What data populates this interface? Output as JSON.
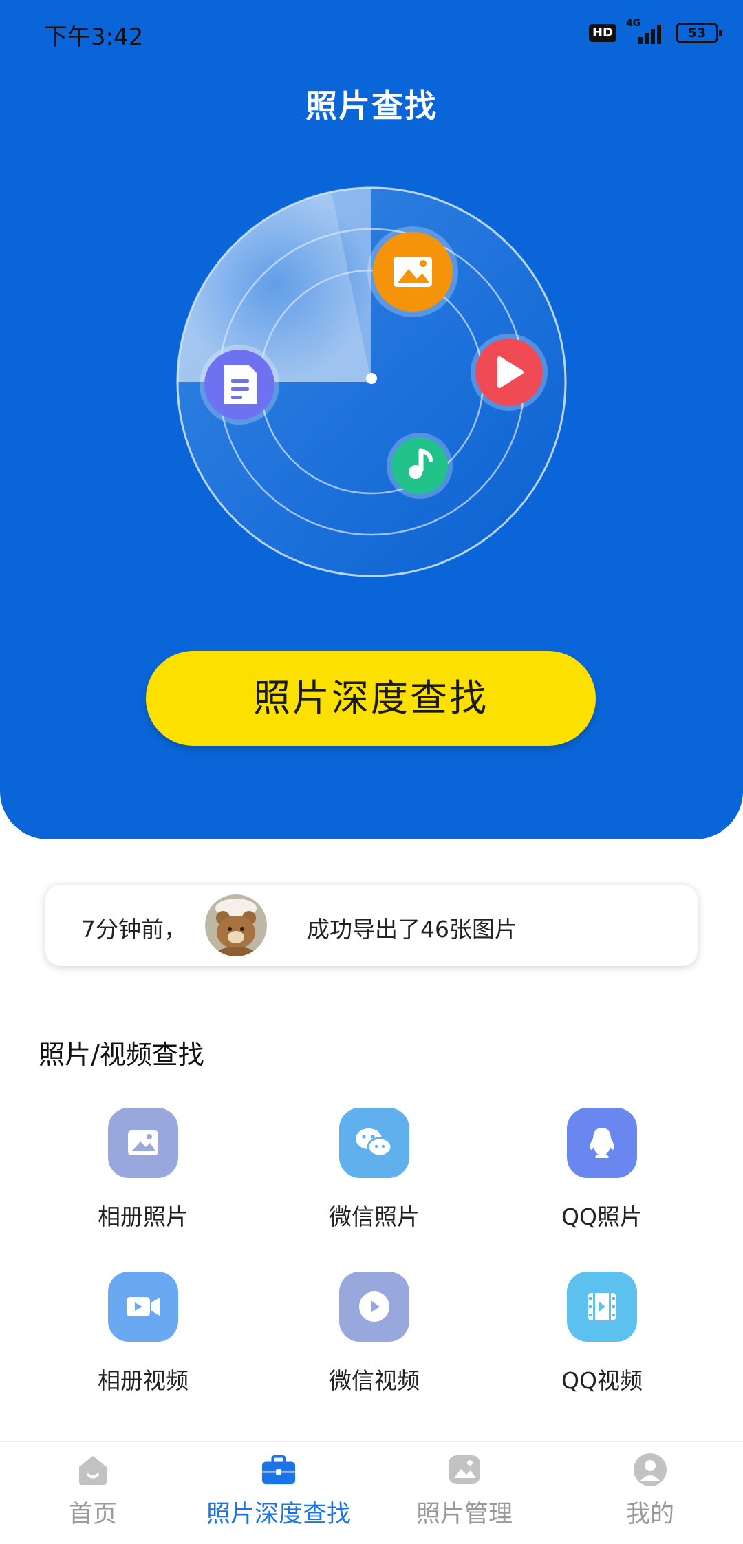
{
  "status_bar": {
    "time": "下午3:42",
    "hd": "HD",
    "network": "4G",
    "battery": "53"
  },
  "header": {
    "title": "照片查找"
  },
  "radar": {
    "icons": [
      "image-icon",
      "play-icon",
      "document-icon",
      "music-note-icon"
    ],
    "colors": {
      "image": "#f5930a",
      "play": "#f04a55",
      "document": "#6f72f0",
      "music": "#22c38a"
    }
  },
  "primary_button": {
    "label": "照片深度查找"
  },
  "notice": {
    "time": "7分钟前，",
    "message": "成功导出了46张图片"
  },
  "section": {
    "title": "照片/视频查找"
  },
  "grid": [
    {
      "label": "相册照片",
      "icon": "album-photo-icon",
      "color": "#98a8dc"
    },
    {
      "label": "微信照片",
      "icon": "wechat-icon",
      "color": "#5fb0ec"
    },
    {
      "label": "QQ照片",
      "icon": "qq-icon",
      "color": "#6a86ef"
    },
    {
      "label": "相册视频",
      "icon": "album-video-icon",
      "color": "#6aa8f2"
    },
    {
      "label": "微信视频",
      "icon": "wechat-video-icon",
      "color": "#98a8dc"
    },
    {
      "label": "QQ视频",
      "icon": "qq-video-icon",
      "color": "#5cc1ef"
    }
  ],
  "bottom_nav": [
    {
      "label": "首页",
      "icon": "home-icon",
      "active": false
    },
    {
      "label": "照片深度查找",
      "icon": "briefcase-icon",
      "active": true
    },
    {
      "label": "照片管理",
      "icon": "gallery-icon",
      "active": false
    },
    {
      "label": "我的",
      "icon": "profile-icon",
      "active": false
    }
  ],
  "colors": {
    "primary": "#0a66d8",
    "button": "#fce100",
    "active_nav": "#1a73e8",
    "inactive_nav": "#999999"
  }
}
